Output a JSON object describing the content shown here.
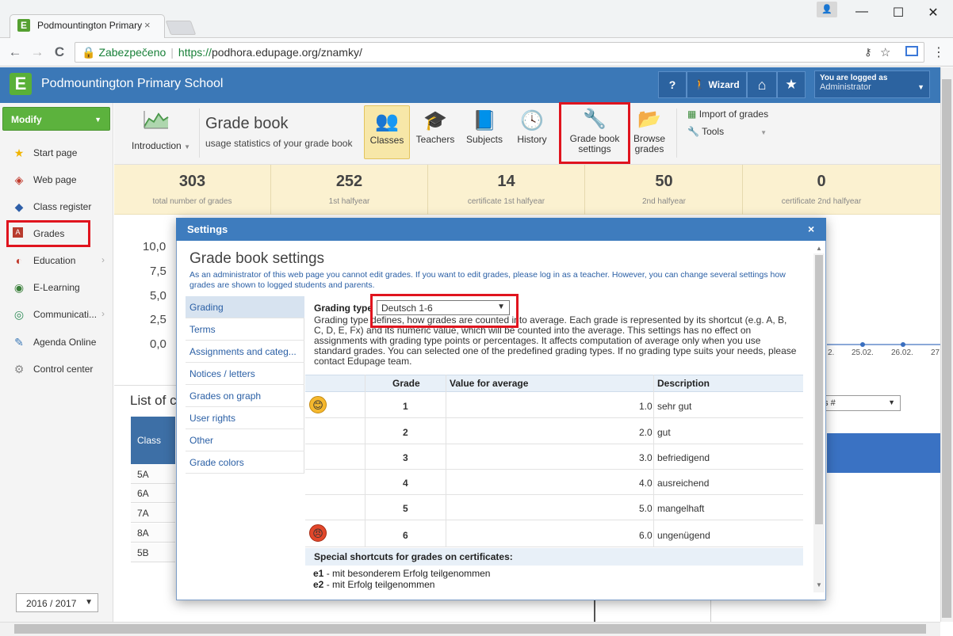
{
  "browser": {
    "tab_title": "Podmountington Primary",
    "tab_close": "×",
    "address_secure_label": "Zabezpečeno",
    "address_url_scheme": "https://",
    "address_url_rest": "podhora.edupage.org/znamky/",
    "back_glyph": "←",
    "forward_glyph": "→",
    "reload_glyph": "C",
    "window_min": "—",
    "window_max": "☐",
    "window_close": "✕"
  },
  "app": {
    "logo_letter": "E",
    "title": "Podmountington Primary School",
    "help_label": "?",
    "wizard_label": "Wizard",
    "home_glyph": "⌂",
    "star_glyph": "★",
    "logged_in_label": "You are logged as",
    "logged_in_user": "Administrator",
    "brand_color": "#3b78b7"
  },
  "sidebar": {
    "modify_label": "Modify",
    "items": [
      {
        "label": "Start page",
        "icon": "star-icon",
        "glyph": "★"
      },
      {
        "label": "Web page",
        "icon": "web-icon",
        "glyph": "◈"
      },
      {
        "label": "Class register",
        "icon": "book-icon",
        "glyph": "◆"
      },
      {
        "label": "Grades",
        "icon": "grades-icon",
        "glyph": "A"
      },
      {
        "label": "Education",
        "icon": "education-icon",
        "glyph": "◐"
      },
      {
        "label": "E-Learning",
        "icon": "elearning-icon",
        "glyph": "◉"
      },
      {
        "label": "Communicati...",
        "icon": "communication-icon",
        "glyph": "◎"
      },
      {
        "label": "Agenda Online",
        "icon": "pen-icon",
        "glyph": "✎"
      },
      {
        "label": "Control center",
        "icon": "gear-icon",
        "glyph": "⚙"
      }
    ],
    "school_year": "2016 / 2017"
  },
  "toolbar": {
    "intro_label": "Introduction",
    "title": "Grade book",
    "subtitle": "usage statistics of your grade book",
    "classes": "Classes",
    "teachers": "Teachers",
    "subjects": "Subjects",
    "history": "History",
    "settings_line1": "Grade book",
    "settings_line2": "settings",
    "browse_line1": "Browse",
    "browse_line2": "grades",
    "import": "Import of grades",
    "tools": "Tools"
  },
  "stats": [
    {
      "value": "303",
      "caption": "total number of grades"
    },
    {
      "value": "252",
      "caption": "1st halfyear"
    },
    {
      "value": "14",
      "caption": "certificate 1st halfyear"
    },
    {
      "value": "50",
      "caption": "2nd halfyear"
    },
    {
      "value": "0",
      "caption": "certificate 2nd halfyear"
    }
  ],
  "background": {
    "yticks": [
      "10,0",
      "7,5",
      "5,0",
      "2,5",
      "0,0"
    ],
    "list_title": "List of c",
    "class_head": "Class",
    "classes": [
      "5A",
      "6A",
      "7A",
      "8A",
      "5B"
    ],
    "right_select": "es #",
    "dates": [
      "2.",
      "25.02.",
      "26.02.",
      "27"
    ]
  },
  "dialog": {
    "header": "Settings",
    "close": "×",
    "title": "Grade book settings",
    "description": "As an administrator of this web page you cannot edit grades. If you want to edit grades, please log in as a teacher. However, you can change several settings how grades are shown to logged students and parents.",
    "nav": [
      "Grading",
      "Terms",
      "Assignments and categ...",
      "Notices / letters",
      "Grades on graph",
      "User rights",
      "Other",
      "Grade colors"
    ],
    "grading_type_label": "Grading type",
    "grading_type_value": "Deutsch 1-6",
    "grading_desc": "Grading type defines, how grades are counted into average. Each grade is represented by its shortcut (e.g. A, B, C, D, E, Fx) and its numeric value, which will be counted into the average. This settings has no effect on assignments with grading type points or percentages. It affects computation of average only when you use standard grades. You can selected one of the predefined grading types. If no grading type suits your needs, please contact Edupage team.",
    "table_headers": [
      "Grade",
      "Value for average",
      "Description"
    ],
    "rows": [
      {
        "grade": "1",
        "value": "1.0",
        "desc": "sehr gut"
      },
      {
        "grade": "2",
        "value": "2.0",
        "desc": "gut"
      },
      {
        "grade": "3",
        "value": "3.0",
        "desc": "befriedigend"
      },
      {
        "grade": "4",
        "value": "4.0",
        "desc": "ausreichend"
      },
      {
        "grade": "5",
        "value": "5.0",
        "desc": "mangelhaft"
      },
      {
        "grade": "6",
        "value": "6.0",
        "desc": "ungenügend"
      }
    ],
    "special_title": "Special shortcuts for grades on certificates:",
    "special": [
      {
        "code": "e1",
        "text": " - mit besonderem Erfolg teilgenommen"
      },
      {
        "code": "e2",
        "text": " - mit Erfolg teilgenommen"
      }
    ]
  }
}
